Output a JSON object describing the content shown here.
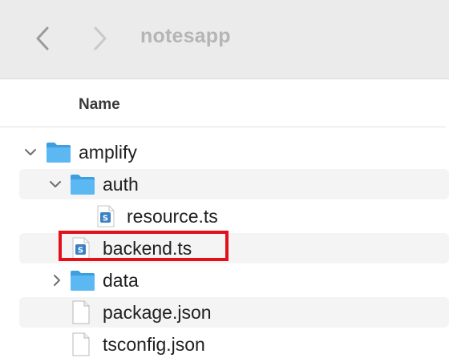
{
  "window": {
    "title": "notesapp",
    "back_icon": "chevron-left-icon",
    "forward_icon": "chevron-right-icon"
  },
  "header": {
    "name_column": "Name"
  },
  "files": [
    {
      "name": "amplify",
      "kind": "folder",
      "expanded": true,
      "level": 0
    },
    {
      "name": "auth",
      "kind": "folder",
      "expanded": true,
      "level": 1
    },
    {
      "name": "resource.ts",
      "kind": "typescript",
      "level": 2
    },
    {
      "name": "backend.ts",
      "kind": "typescript",
      "level": 1,
      "highlighted": true
    },
    {
      "name": "data",
      "kind": "folder",
      "expanded": false,
      "level": 1
    },
    {
      "name": "package.json",
      "kind": "document",
      "level": 1
    },
    {
      "name": "tsconfig.json",
      "kind": "document",
      "level": 1
    }
  ],
  "colors": {
    "folder": "#5cb8f2",
    "highlight": "#e3101c",
    "typescript_badge": "#3b82c4"
  }
}
